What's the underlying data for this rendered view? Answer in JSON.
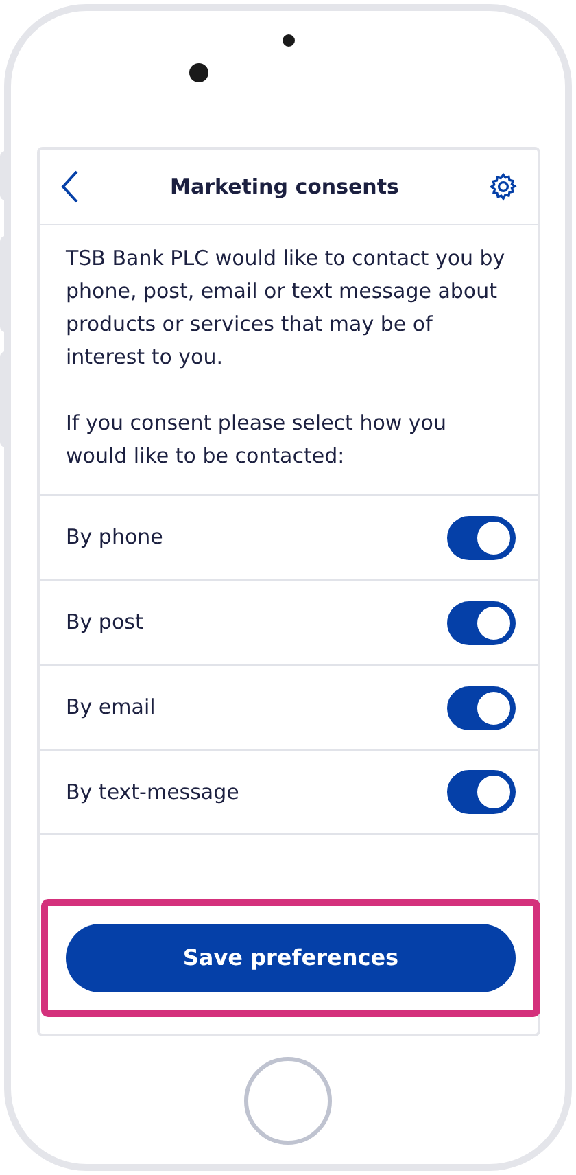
{
  "header": {
    "title": "Marketing consents"
  },
  "intro": [
    "TSB Bank PLC would like to contact you by phone, post, email or text message about products or services that may be of interest to you.",
    "If you consent please select how you would like to be contacted:"
  ],
  "options": [
    {
      "label": "By phone",
      "on": true
    },
    {
      "label": "By post",
      "on": true
    },
    {
      "label": "By email",
      "on": true
    },
    {
      "label": "By text-message",
      "on": true
    }
  ],
  "save_button": {
    "label": "Save preferences",
    "highlighted": true
  }
}
